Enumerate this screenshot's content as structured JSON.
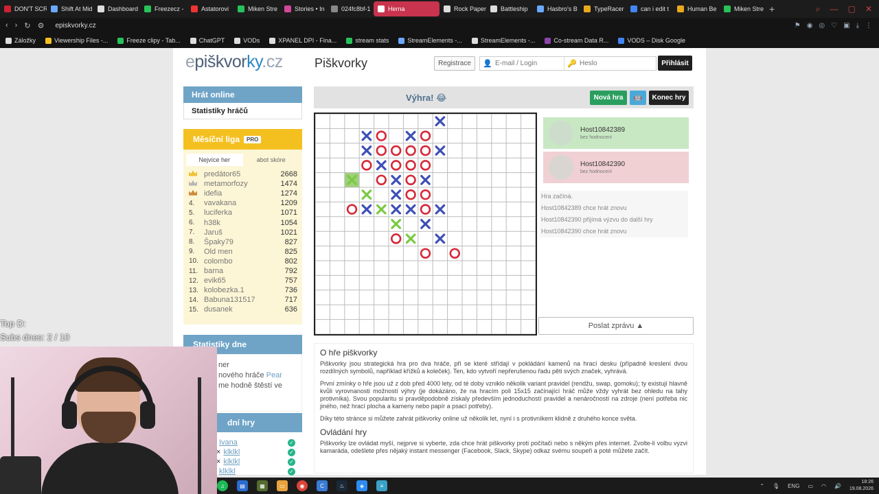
{
  "browser": {
    "tabs": [
      {
        "label": "DON'T SCR",
        "color": "#c23"
      },
      {
        "label": "Shift At Mid",
        "color": "#6aa9ff"
      },
      {
        "label": "Dashboard",
        "color": "#ddd"
      },
      {
        "label": "Freezecz -",
        "color": "#27c25a"
      },
      {
        "label": "Astatorovi",
        "color": "#e33"
      },
      {
        "label": "Miken Stre",
        "color": "#27c25a"
      },
      {
        "label": "Stories • In",
        "color": "#d4489a"
      },
      {
        "label": "024fc8bf-1",
        "color": "#888"
      },
      {
        "label": "Herna",
        "color": "#fff",
        "active": true
      },
      {
        "label": "Rock Paper",
        "color": "#ddd"
      },
      {
        "label": "Battleship",
        "color": "#ddd"
      },
      {
        "label": "Hasbro's B",
        "color": "#6aa9ff"
      },
      {
        "label": "TypeRacer",
        "color": "#e9a91d"
      },
      {
        "label": "can i edit t",
        "color": "#4285f4"
      },
      {
        "label": "Human Be",
        "color": "#e9a91d"
      },
      {
        "label": "Miken Stre",
        "color": "#27c25a"
      }
    ],
    "url": "episkvorky.cz",
    "bookmarks": [
      {
        "label": "Záložky",
        "color": "#ddd"
      },
      {
        "label": "Viewership Files -...",
        "color": "#f4c020"
      },
      {
        "label": "Freeze clipy - Tab...",
        "color": "#27c25a"
      },
      {
        "label": "ChatGPT",
        "color": "#ddd"
      },
      {
        "label": "VODs",
        "color": "#ddd"
      },
      {
        "label": "XPANEL DPI - Fina...",
        "color": "#ddd"
      },
      {
        "label": "stream stats",
        "color": "#27c25a"
      },
      {
        "label": "StreamElements -...",
        "color": "#6aa9ff"
      },
      {
        "label": "StreamElements -...",
        "color": "#ddd"
      },
      {
        "label": "Co-stream Data R...",
        "color": "#8e44ad"
      },
      {
        "label": "VODS – Disk Google",
        "color": "#4285f4"
      }
    ]
  },
  "header": {
    "logo_e": "e",
    "logo_mid": "piškvor",
    "logo_ky": "ky",
    "logo_cz": ".cz",
    "title": "Piškvorky",
    "register": "Registrace",
    "email_placeholder": "E-mail / Login",
    "password_placeholder": "Heslo",
    "login": "Přihlásit"
  },
  "sidebar": {
    "play_online": "Hrát online",
    "player_stats": "Statistiky hráčů",
    "league_title": "Měsíční liga",
    "pro_badge": "PRO",
    "tab_most_games": "Nejvíce her",
    "tab_score": "abot skóre",
    "league": [
      {
        "rank": "",
        "crown": "#f0c030",
        "name": "predátor65",
        "score": "2668"
      },
      {
        "rank": "",
        "crown": "#b8b8b8",
        "name": "metamorfozy",
        "score": "1474"
      },
      {
        "rank": "",
        "crown": "#cd8a3c",
        "name": "idefia",
        "score": "1274"
      },
      {
        "rank": "4.",
        "name": "vavakana",
        "score": "1209"
      },
      {
        "rank": "5.",
        "name": "luciferka",
        "score": "1071"
      },
      {
        "rank": "6.",
        "name": "h38k",
        "score": "1054"
      },
      {
        "rank": "7.",
        "name": "Jaruš",
        "score": "1021"
      },
      {
        "rank": "8.",
        "name": "Špaky79",
        "score": "827"
      },
      {
        "rank": "9.",
        "name": "Old men",
        "score": "825"
      },
      {
        "rank": "10.",
        "name": "colombo",
        "score": "802"
      },
      {
        "rank": "11.",
        "name": "barna",
        "score": "792"
      },
      {
        "rank": "12.",
        "name": "evik65",
        "score": "757"
      },
      {
        "rank": "13.",
        "name": "kolobezka.1",
        "score": "736"
      },
      {
        "rank": "14.",
        "name": "Babuna131517",
        "score": "717"
      },
      {
        "rank": "15.",
        "name": "dusanek",
        "score": "636"
      }
    ],
    "day_stats_title": "Statistiky dne",
    "day_stats_line1": "ner",
    "day_stats_line2": "nového hráče",
    "day_stats_player": "Pear",
    "day_stats_line3": "me hodně štěstí ve",
    "games_title": "dní hry",
    "games": [
      {
        "prefix": "",
        "name": "Ivana"
      },
      {
        "prefix": "×",
        "name": "klklkl"
      },
      {
        "prefix": "×",
        "name": "klklkl"
      },
      {
        "prefix": "",
        "name": "klklkl"
      }
    ]
  },
  "game": {
    "result": "Výhra! 😂",
    "new_game": "Nová hra",
    "end_game": "Konec hry",
    "grid_size": 15,
    "marks": [
      {
        "c": 8,
        "r": 0,
        "t": "x"
      },
      {
        "c": 3,
        "r": 1,
        "t": "x"
      },
      {
        "c": 4,
        "r": 1,
        "t": "o"
      },
      {
        "c": 6,
        "r": 1,
        "t": "x"
      },
      {
        "c": 7,
        "r": 1,
        "t": "o"
      },
      {
        "c": 3,
        "r": 2,
        "t": "x"
      },
      {
        "c": 4,
        "r": 2,
        "t": "o"
      },
      {
        "c": 5,
        "r": 2,
        "t": "o"
      },
      {
        "c": 6,
        "r": 2,
        "t": "o"
      },
      {
        "c": 7,
        "r": 2,
        "t": "o"
      },
      {
        "c": 8,
        "r": 2,
        "t": "x"
      },
      {
        "c": 3,
        "r": 3,
        "t": "o"
      },
      {
        "c": 4,
        "r": 3,
        "t": "x"
      },
      {
        "c": 5,
        "r": 3,
        "t": "o"
      },
      {
        "c": 6,
        "r": 3,
        "t": "o"
      },
      {
        "c": 7,
        "r": 3,
        "t": "o"
      },
      {
        "c": 2,
        "r": 4,
        "t": "xw",
        "hl": true
      },
      {
        "c": 4,
        "r": 4,
        "t": "o"
      },
      {
        "c": 5,
        "r": 4,
        "t": "x"
      },
      {
        "c": 6,
        "r": 4,
        "t": "o"
      },
      {
        "c": 7,
        "r": 4,
        "t": "x"
      },
      {
        "c": 3,
        "r": 5,
        "t": "xw"
      },
      {
        "c": 5,
        "r": 5,
        "t": "x"
      },
      {
        "c": 6,
        "r": 5,
        "t": "o"
      },
      {
        "c": 7,
        "r": 5,
        "t": "o"
      },
      {
        "c": 2,
        "r": 6,
        "t": "o"
      },
      {
        "c": 3,
        "r": 6,
        "t": "x"
      },
      {
        "c": 4,
        "r": 6,
        "t": "xw"
      },
      {
        "c": 5,
        "r": 6,
        "t": "x"
      },
      {
        "c": 6,
        "r": 6,
        "t": "x"
      },
      {
        "c": 7,
        "r": 6,
        "t": "o"
      },
      {
        "c": 8,
        "r": 6,
        "t": "x"
      },
      {
        "c": 5,
        "r": 7,
        "t": "xw"
      },
      {
        "c": 7,
        "r": 7,
        "t": "x"
      },
      {
        "c": 5,
        "r": 8,
        "t": "o"
      },
      {
        "c": 6,
        "r": 8,
        "t": "xw"
      },
      {
        "c": 8,
        "r": 8,
        "t": "x"
      },
      {
        "c": 7,
        "r": 9,
        "t": "o"
      },
      {
        "c": 9,
        "r": 9,
        "t": "o"
      }
    ],
    "player1": {
      "name": "Host10842389",
      "rating": "bez hodnocení",
      "bg": "#c8e8c4"
    },
    "player2": {
      "name": "Host10842390",
      "rating": "bez hodnocení",
      "bg": "#f0d0d2"
    },
    "log": [
      "Hra začíná.",
      "Host10842389 chce hrát znovu",
      "Host10842390 přijímá výzvu do další hry",
      "Host10842390 chce hrát znovu"
    ],
    "send_message": "Poslat zprávu ▲"
  },
  "about": {
    "title": "O hře piškvorky",
    "p1": "Piškvorky jsou strategická hra pro dva hráče, při se které střídají v pokládání kamenů na hrací desku (případně kreslení dvou rozdílných symbolů, například křížků a koleček). Ten, kdo vytvoří nepřerušenou řadu pěti svých značek, vyhrává.",
    "p2": "První zmínky o hře jsou už z dob před 4000 lety, od té doby vzniklo několik variant pravidel (rendžu, swap, gomoku); ty existují hlavně kvůli vyrovnanosti možností výhry (je dokázáno, že na hracím poli 15x15 začínající hráč může vždy vyhrát bez ohledu na tahy protivníka). Svou popularitu si pravděpodobně získaly především jednoduchostí pravidel a nenáročností na zdroje (není potřeba nic jiného, než hrací plocha a kameny nebo papír a psací potřeby).",
    "p3": "Díky této stránce si můžete zahrát piškvorky online už několik let, nyní i s protivníkem klidně z druhého konce světa.",
    "title2": "Ovládání hry",
    "p4": "Piškvorky lze ovládat myší, nejprve si vyberte, zda chce hrát piškvorky proti počítači nebo s někým přes internet. Zvolte-li volbu vyzvi kamaráda, odešlete přes nějaký instant messenger (Facebook, Slack, Skype) odkaz svému soupeři a poté můžete začít."
  },
  "overlay": {
    "top": "Top D:",
    "subs": "Subs dnes: 2 / 10"
  },
  "taskbar": {
    "lang": "ENG",
    "time": "18:26",
    "date": "19.08.2026"
  },
  "colors": {
    "x": "#3d4fb8",
    "o": "#d62839",
    "x_win": "#7ac943",
    "highlight": "#9fd07a"
  }
}
